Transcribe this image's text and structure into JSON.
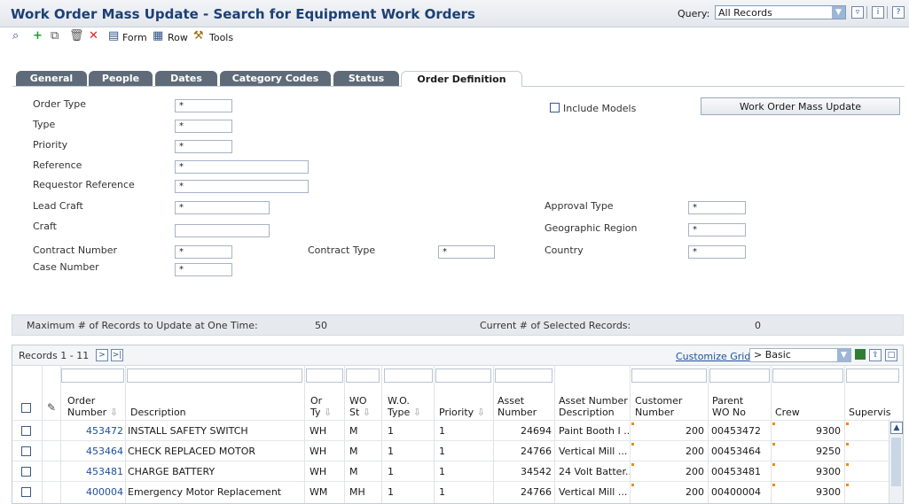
{
  "header": {
    "title": "Work Order Mass Update - Search for Equipment Work Orders",
    "query_label": "Query:",
    "query_value": "All Records"
  },
  "toolbar": {
    "form": "Form",
    "row": "Row",
    "tools": "Tools"
  },
  "tabs": [
    "General",
    "People",
    "Dates",
    "Category Codes",
    "Status",
    "Order Definition"
  ],
  "form": {
    "order_type": {
      "label": "Order Type",
      "value": "*"
    },
    "type": {
      "label": "Type",
      "value": "*"
    },
    "priority": {
      "label": "Priority",
      "value": "*"
    },
    "reference": {
      "label": "Reference",
      "value": "*"
    },
    "requestor_reference": {
      "label": "Requestor Reference",
      "value": "*"
    },
    "lead_craft": {
      "label": "Lead Craft",
      "value": "*"
    },
    "craft": {
      "label": "Craft",
      "value": ""
    },
    "contract_number": {
      "label": "Contract Number",
      "value": "*"
    },
    "case_number": {
      "label": "Case Number",
      "value": "*"
    },
    "contract_type": {
      "label": "Contract Type",
      "value": "*"
    },
    "include_models": "Include Models",
    "approval_type": {
      "label": "Approval Type",
      "value": "*"
    },
    "geographic_region": {
      "label": "Geographic Region",
      "value": "*"
    },
    "country": {
      "label": "Country",
      "value": "*"
    },
    "mass_update_button": "Work Order Mass Update"
  },
  "info": {
    "max_label": "Maximum # of Records to Update at One Time:",
    "max_value": "50",
    "current_label": "Current # of Selected Records:",
    "current_value": "0"
  },
  "grid": {
    "records": "Records 1 - 11",
    "customize": "Customize Grid",
    "format": "> Basic",
    "columns": {
      "order_number": [
        "Order",
        "Number"
      ],
      "description": "Description",
      "or_ty": [
        "Or",
        "Ty"
      ],
      "wo_st": [
        "WO",
        "St"
      ],
      "wo_type": [
        "W.O.",
        "Type"
      ],
      "priority": "Priority",
      "asset_number": [
        "Asset",
        "Number"
      ],
      "asset_desc": [
        "Asset Number",
        "Description"
      ],
      "customer": [
        "Customer",
        "Number"
      ],
      "parent": [
        "Parent",
        "WO No"
      ],
      "crew": "Crew",
      "supervisor": "Supervis"
    },
    "rows": [
      {
        "order": "453472",
        "desc": "INSTALL SAFETY SWITCH",
        "orty": "WH",
        "wost": "M",
        "wotype": "1",
        "priority": "1",
        "asset": "24694",
        "asset_desc": "Paint Booth I ...",
        "customer": "200",
        "parent": "00453472",
        "crew": "9300"
      },
      {
        "order": "453464",
        "desc": "CHECK REPLACED MOTOR",
        "orty": "WH",
        "wost": "M",
        "wotype": "1",
        "priority": "1",
        "asset": "24766",
        "asset_desc": "Vertical Mill   ...",
        "customer": "200",
        "parent": "00453464",
        "crew": "9250"
      },
      {
        "order": "453481",
        "desc": "CHARGE BATTERY",
        "orty": "WH",
        "wost": "M",
        "wotype": "1",
        "priority": "1",
        "asset": "34542",
        "asset_desc": "24 Volt Batter...",
        "customer": "200",
        "parent": "00453481",
        "crew": "9300"
      },
      {
        "order": "400004",
        "desc": "Emergency Motor Replacement",
        "orty": "WM",
        "wost": "MH",
        "wotype": "1",
        "priority": "1",
        "asset": "24766",
        "asset_desc": "Vertical Mill   ...",
        "customer": "200",
        "parent": "00400004",
        "crew": "9300"
      }
    ]
  }
}
